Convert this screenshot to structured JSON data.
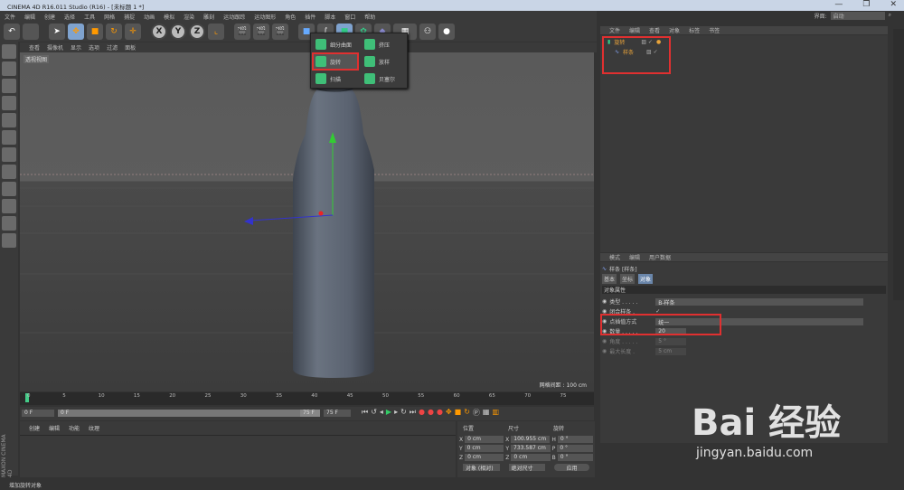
{
  "window": {
    "title": "CINEMA 4D R16.011 Studio (R16) - [未标题 1 *]",
    "controls": [
      "—",
      "❐",
      "✕"
    ]
  },
  "menu": [
    "文件",
    "编辑",
    "创建",
    "选择",
    "工具",
    "网格",
    "捕捉",
    "动画",
    "模拟",
    "渲染",
    "雕刻",
    "运动跟踪",
    "运动图形",
    "角色",
    "插件",
    "脚本",
    "窗口",
    "帮助"
  ],
  "toolbar": {
    "x": "X",
    "y": "Y",
    "z": "Z"
  },
  "viewport": {
    "menu": [
      "查看",
      "摄像机",
      "显示",
      "选项",
      "过滤",
      "面板"
    ],
    "label": "透视视图",
    "grid": "网格间距 : 100 cm"
  },
  "popup": {
    "items": [
      "细分曲面",
      "挤压",
      "旋转",
      "放样",
      "扫描",
      "贝塞尔"
    ],
    "highlighted": "旋转"
  },
  "interface": {
    "label": "界面:",
    "value": "启动"
  },
  "object_manager": {
    "menu": [
      "文件",
      "编辑",
      "查看",
      "对象",
      "标签",
      "书签"
    ],
    "objects": [
      {
        "name": "旋转"
      },
      {
        "name": "样条"
      }
    ]
  },
  "attributes": {
    "menu": [
      "模式",
      "编辑",
      "用户数据"
    ],
    "object": "样条 [样条]",
    "tabs": [
      "基本",
      "坐标",
      "对象"
    ],
    "section": "对象属性",
    "fields": [
      {
        "label": "类型 . . . . .",
        "value": "B-样条"
      },
      {
        "label": "闭合样条 .",
        "value": "✓"
      },
      {
        "label": "点插值方式",
        "value": "统一"
      },
      {
        "label": "数量 . . . . .",
        "value": "20"
      },
      {
        "label": "角度 . . . . .",
        "value": "5 °"
      },
      {
        "label": "最大长度 .",
        "value": "5 cm"
      }
    ]
  },
  "timeline": {
    "ticks": [
      "0",
      "5",
      "10",
      "15",
      "20",
      "25",
      "30",
      "35",
      "40",
      "45",
      "50",
      "55",
      "60",
      "65",
      "70",
      "75"
    ],
    "frame_field": "0 F",
    "start": "0 F",
    "end": "75 F",
    "end2": "75 F",
    "current": "0 F"
  },
  "material_manager": {
    "menu": [
      "创建",
      "编辑",
      "功能",
      "纹理"
    ]
  },
  "coordinates": {
    "headers": [
      "位置",
      "尺寸",
      "旋转"
    ],
    "rows": [
      {
        "axis": "X",
        "pos": "0 cm",
        "size": "100.955 cm",
        "rot_axis": "H",
        "rot": "0 °"
      },
      {
        "axis": "Y",
        "pos": "0 cm",
        "size": "733.587 cm",
        "rot_axis": "P",
        "rot": "0 °"
      },
      {
        "axis": "Z",
        "pos": "0 cm",
        "size": "0 cm",
        "rot_axis": "B",
        "rot": "0 °"
      }
    ],
    "mode": "对象 (相对)",
    "size_mode": "绝对尺寸",
    "apply": "应用"
  },
  "status": "增加旋转对象",
  "logo": "MAXON CINEMA 4D",
  "watermark": {
    "brand": "Bai 经验",
    "url": "jingyan.baidu.com"
  }
}
